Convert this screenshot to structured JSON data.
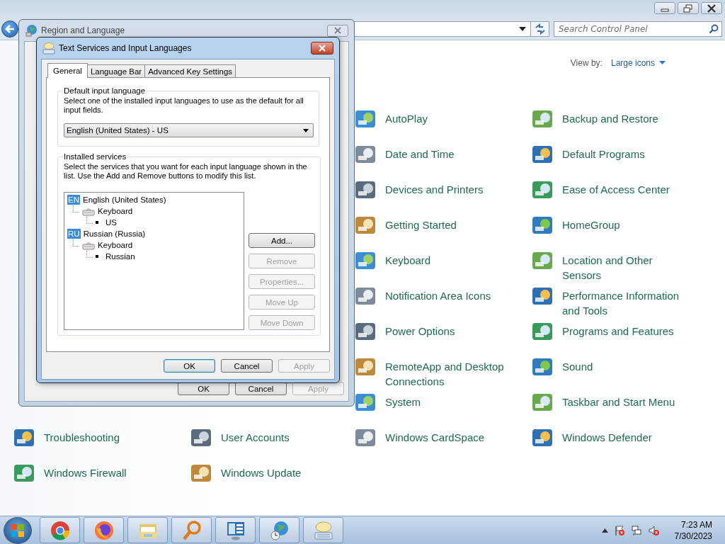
{
  "control_panel": {
    "search": {
      "placeholder": "Search Control Panel"
    },
    "view_by": {
      "label": "View by:",
      "value": "Large icons"
    },
    "items_left": [
      {
        "label": "Troubleshooting"
      },
      {
        "label": "User Accounts"
      },
      {
        "label": "Windows Firewall"
      },
      {
        "label": "Windows Update"
      }
    ],
    "items_right": [
      {
        "label": "AutoPlay"
      },
      {
        "label": "Backup and Restore"
      },
      {
        "label": "Date and Time"
      },
      {
        "label": "Default Programs"
      },
      {
        "label": "Devices and Printers"
      },
      {
        "label": "Ease of Access Center"
      },
      {
        "label": "Getting Started"
      },
      {
        "label": "HomeGroup"
      },
      {
        "label": "Keyboard"
      },
      {
        "label": "Location and Other Sensors"
      },
      {
        "label": "Notification Area Icons"
      },
      {
        "label": "Performance Information and Tools"
      },
      {
        "label": "Power Options"
      },
      {
        "label": "Programs and Features"
      },
      {
        "label": "RemoteApp and Desktop Connections"
      },
      {
        "label": "Sound"
      },
      {
        "label": "System"
      },
      {
        "label": "Taskbar and Start Menu"
      },
      {
        "label": "Windows CardSpace"
      },
      {
        "label": "Windows Defender"
      }
    ]
  },
  "region_dialog": {
    "title": "Region and Language",
    "buttons": [
      {
        "label": "OK",
        "disabled": false
      },
      {
        "label": "Cancel",
        "disabled": false
      },
      {
        "label": "Apply",
        "disabled": true
      }
    ]
  },
  "text_services_dialog": {
    "title": "Text Services and Input Languages",
    "tabs": [
      {
        "label": "General",
        "selected": true
      },
      {
        "label": "Language Bar",
        "selected": false
      },
      {
        "label": "Advanced Key Settings",
        "selected": false
      }
    ],
    "default_group": {
      "label": "Default input language",
      "description": "Select one of the installed input languages to use as the default for all input fields.",
      "value": "English (United States) - US"
    },
    "services_group": {
      "label": "Installed services",
      "description": "Select the services that you want for each input language shown in the list. Use the Add and Remove buttons to modify this list.",
      "languages": [
        {
          "badge": "EN",
          "name": "English (United States)",
          "children": [
            {
              "label": "Keyboard",
              "children": [
                {
                  "label": "US"
                }
              ]
            }
          ]
        },
        {
          "badge": "RU",
          "name": "Russian (Russia)",
          "children": [
            {
              "label": "Keyboard",
              "children": [
                {
                  "label": "Russian"
                }
              ]
            }
          ]
        }
      ],
      "buttons": [
        {
          "label": "Add...",
          "disabled": false
        },
        {
          "label": "Remove",
          "disabled": true
        },
        {
          "label": "Properties...",
          "disabled": true
        },
        {
          "label": "Move Up",
          "disabled": true
        },
        {
          "label": "Move Down",
          "disabled": true
        }
      ]
    },
    "buttons": [
      {
        "label": "OK",
        "disabled": false,
        "default": true
      },
      {
        "label": "Cancel",
        "disabled": false,
        "default": false
      },
      {
        "label": "Apply",
        "disabled": true,
        "default": false
      }
    ]
  },
  "taskbar": {
    "time": "7:23 AM",
    "date": "7/30/2023"
  }
}
